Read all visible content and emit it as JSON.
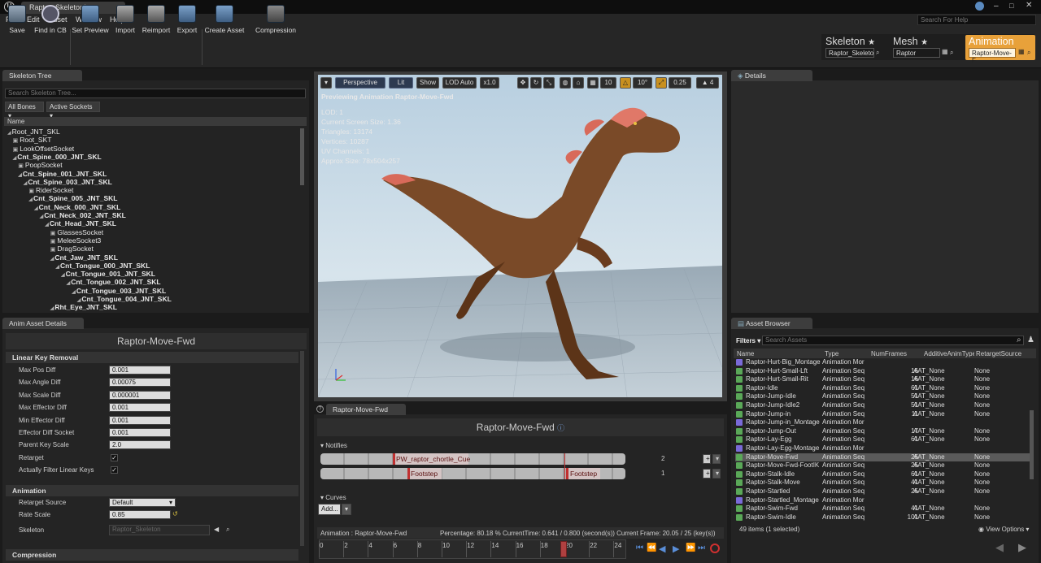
{
  "window": {
    "tab_title": "Raptor_Skeleton*"
  },
  "menu": [
    "File",
    "Edit",
    "Asset",
    "Window",
    "Help"
  ],
  "help_search_placeholder": "Search For Help",
  "toolbar": [
    {
      "label": "Save",
      "icon": "save-icon"
    },
    {
      "label": "Find in CB",
      "icon": "magnifier-icon"
    },
    {
      "label": "Set Preview",
      "icon": "preview-icon"
    },
    {
      "label": "Import",
      "icon": "import-icon"
    },
    {
      "label": "Reimport",
      "icon": "reimport-icon"
    },
    {
      "label": "Export",
      "icon": "export-icon"
    },
    {
      "label": "Create Asset",
      "icon": "create-asset-icon"
    },
    {
      "label": "Compression",
      "icon": "compression-icon"
    }
  ],
  "breadcrumb": {
    "skeleton": {
      "title": "Skeleton",
      "field": "Raptor_Skeleto"
    },
    "mesh": {
      "title": "Mesh",
      "field": "Raptor"
    },
    "animation": {
      "title": "Animation",
      "field": "Raptor-Move-F"
    }
  },
  "skeleton_tree": {
    "tab": "Skeleton Tree",
    "search_placeholder": "Search Skeleton Tree...",
    "filter_bones": "All Bones",
    "filter_sockets": "Active Sockets",
    "column": "Name",
    "rows": [
      {
        "label": "Root_JNT_SKL",
        "bold": false,
        "indent": 0
      },
      {
        "label": "Root_SKT",
        "bold": false,
        "indent": 1
      },
      {
        "label": "LookOffsetSocket",
        "bold": false,
        "indent": 1
      },
      {
        "label": "Cnt_Spine_000_JNT_SKL",
        "bold": true,
        "indent": 1
      },
      {
        "label": "PoopSocket",
        "bold": false,
        "indent": 2
      },
      {
        "label": "Cnt_Spine_001_JNT_SKL",
        "bold": true,
        "indent": 2
      },
      {
        "label": "Cnt_Spine_003_JNT_SKL",
        "bold": true,
        "indent": 3
      },
      {
        "label": "RiderSocket",
        "bold": false,
        "indent": 4
      },
      {
        "label": "Cnt_Spine_005_JNT_SKL",
        "bold": true,
        "indent": 4
      },
      {
        "label": "Cnt_Neck_000_JNT_SKL",
        "bold": true,
        "indent": 5
      },
      {
        "label": "Cnt_Neck_002_JNT_SKL",
        "bold": true,
        "indent": 6
      },
      {
        "label": "Cnt_Head_JNT_SKL",
        "bold": true,
        "indent": 7
      },
      {
        "label": "GlassesSocket",
        "bold": false,
        "indent": 8
      },
      {
        "label": "MeleeSocket3",
        "bold": false,
        "indent": 8
      },
      {
        "label": "DragSocket",
        "bold": false,
        "indent": 8
      },
      {
        "label": "Cnt_Jaw_JNT_SKL",
        "bold": true,
        "indent": 8
      },
      {
        "label": "Cnt_Tongue_000_JNT_SKL",
        "bold": true,
        "indent": 9
      },
      {
        "label": "Cnt_Tongue_001_JNT_SKL",
        "bold": true,
        "indent": 10
      },
      {
        "label": "Cnt_Tongue_002_JNT_SKL",
        "bold": true,
        "indent": 11
      },
      {
        "label": "Cnt_Tongue_003_JNT_SKL",
        "bold": true,
        "indent": 12
      },
      {
        "label": "Cnt_Tongue_004_JNT_SKL",
        "bold": true,
        "indent": 13
      },
      {
        "label": "Rht_Eye_JNT_SKL",
        "bold": true,
        "indent": 8
      }
    ]
  },
  "anim_details": {
    "tab": "Anim Asset Details",
    "title": "Raptor-Move-Fwd",
    "section_lkr": "Linear Key Removal",
    "props": [
      {
        "label": "Max Pos Diff",
        "value": "0.001"
      },
      {
        "label": "Max Angle Diff",
        "value": "0.00075"
      },
      {
        "label": "Max Scale Diff",
        "value": "0.000001"
      },
      {
        "label": "Max Effector Diff",
        "value": "0.001"
      },
      {
        "label": "Min Effector Diff",
        "value": "0.001"
      },
      {
        "label": "Effector Diff Socket",
        "value": "0.001"
      },
      {
        "label": "Parent Key Scale",
        "value": "2.0"
      }
    ],
    "retarget_label": "Retarget",
    "filter_label": "Actually Filter Linear Keys",
    "section_anim": "Animation",
    "retarget_source_label": "Retarget Source",
    "retarget_source_value": "Default",
    "rate_scale_label": "Rate Scale",
    "rate_scale_value": "0.85",
    "skeleton_label": "Skeleton",
    "skeleton_value": "Raptor_Skeleton",
    "section_compression": "Compression"
  },
  "viewport": {
    "perspective": "Perspective",
    "lit": "Lit",
    "show": "Show",
    "lod": "LOD Auto",
    "speed": "x1.0",
    "grid": "10",
    "angle": "10°",
    "scale": "0.25",
    "cam": "4",
    "stats": [
      "Previewing Animation Raptor-Move-Fwd",
      "LOD: 1",
      "Current Screen Size: 1.36",
      "Triangles: 13174",
      "Vertices: 10287",
      "UV Channels: 1",
      "Approx Size: 78x504x257"
    ]
  },
  "anim_editor": {
    "tab": "Raptor-Move-Fwd",
    "title": "Raptor-Move-Fwd",
    "notifies_label": "Notifies",
    "notify1": "PW_raptor_chortle_Cue",
    "notify2": "Footstep",
    "notify3": "Footstep",
    "track1_num": "2",
    "track2_num": "1",
    "curves_label": "Curves",
    "add_btn": "Add...",
    "status_animation": "Animation :  Raptor-Move-Fwd",
    "status_percentage": "Percentage:  80.18 %  CurrentTime:  0.641 / 0.800 (second(s))  Current Frame:  20.05 / 25 (key(s))",
    "ticks": [
      "0",
      "2",
      "4",
      "6",
      "8",
      "10",
      "12",
      "14",
      "16",
      "18",
      "20",
      "22",
      "24"
    ],
    "playhead_fraction": 0.8018
  },
  "details": {
    "tab": "Details"
  },
  "asset_browser": {
    "tab": "Asset Browser",
    "filters": "Filters",
    "search_placeholder": "Search Assets",
    "columns": [
      "Name",
      "Type",
      "NumFrames",
      "AdditiveAnimType",
      "RetargetSource"
    ],
    "rows": [
      {
        "name": "Raptor-Hurt-Big_Montage",
        "type": "Animation Mor",
        "frames": "",
        "add": "",
        "rt": "",
        "montage": true
      },
      {
        "name": "Raptor-Hurt-Small-Lft",
        "type": "Animation Seq",
        "frames": "16",
        "add": "AAT_None",
        "rt": "None",
        "montage": false
      },
      {
        "name": "Raptor-Hurt-Small-Rit",
        "type": "Animation Seq",
        "frames": "16",
        "add": "AAT_None",
        "rt": "None",
        "montage": false
      },
      {
        "name": "Raptor-Idle",
        "type": "Animation Seq",
        "frames": "61",
        "add": "AAT_None",
        "rt": "None",
        "montage": false
      },
      {
        "name": "Raptor-Jump-Idle",
        "type": "Animation Seq",
        "frames": "51",
        "add": "AAT_None",
        "rt": "None",
        "montage": false
      },
      {
        "name": "Raptor-Jump-Idle2",
        "type": "Animation Seq",
        "frames": "51",
        "add": "AAT_None",
        "rt": "None",
        "montage": false
      },
      {
        "name": "Raptor-Jump-in",
        "type": "Animation Seq",
        "frames": "11",
        "add": "AAT_None",
        "rt": "None",
        "montage": false
      },
      {
        "name": "Raptor-Jump-in_Montage",
        "type": "Animation Mor",
        "frames": "",
        "add": "",
        "rt": "",
        "montage": true
      },
      {
        "name": "Raptor-Jump-Out",
        "type": "Animation Seq",
        "frames": "17",
        "add": "AAT_None",
        "rt": "None",
        "montage": false
      },
      {
        "name": "Raptor-Lay-Egg",
        "type": "Animation Seq",
        "frames": "61",
        "add": "AAT_None",
        "rt": "None",
        "montage": false
      },
      {
        "name": "Raptor-Lay-Egg-Montage",
        "type": "Animation Mor",
        "frames": "",
        "add": "",
        "rt": "",
        "montage": true
      },
      {
        "name": "Raptor-Move-Fwd",
        "type": "Animation Seq",
        "frames": "25",
        "add": "AAT_None",
        "rt": "None",
        "montage": false,
        "selected": true
      },
      {
        "name": "Raptor-Move-Fwd-FootIK",
        "type": "Animation Seq",
        "frames": "25",
        "add": "AAT_None",
        "rt": "None",
        "montage": false
      },
      {
        "name": "Raptor-Stalk-Idle",
        "type": "Animation Seq",
        "frames": "61",
        "add": "AAT_None",
        "rt": "None",
        "montage": false
      },
      {
        "name": "Raptor-Stalk-Move",
        "type": "Animation Seq",
        "frames": "41",
        "add": "AAT_None",
        "rt": "None",
        "montage": false
      },
      {
        "name": "Raptor-Startled",
        "type": "Animation Seq",
        "frames": "25",
        "add": "AAT_None",
        "rt": "None",
        "montage": false
      },
      {
        "name": "Raptor-Startled_Montage",
        "type": "Animation Mor",
        "frames": "",
        "add": "",
        "rt": "",
        "montage": true
      },
      {
        "name": "Raptor-Swim-Fwd",
        "type": "Animation Seq",
        "frames": "41",
        "add": "AAT_None",
        "rt": "None",
        "montage": false
      },
      {
        "name": "Raptor-Swim-Idle",
        "type": "Animation Seq",
        "frames": "101",
        "add": "AAT_None",
        "rt": "None",
        "montage": false
      }
    ],
    "footer": "49 items (1 selected)",
    "view_options": "View Options"
  }
}
